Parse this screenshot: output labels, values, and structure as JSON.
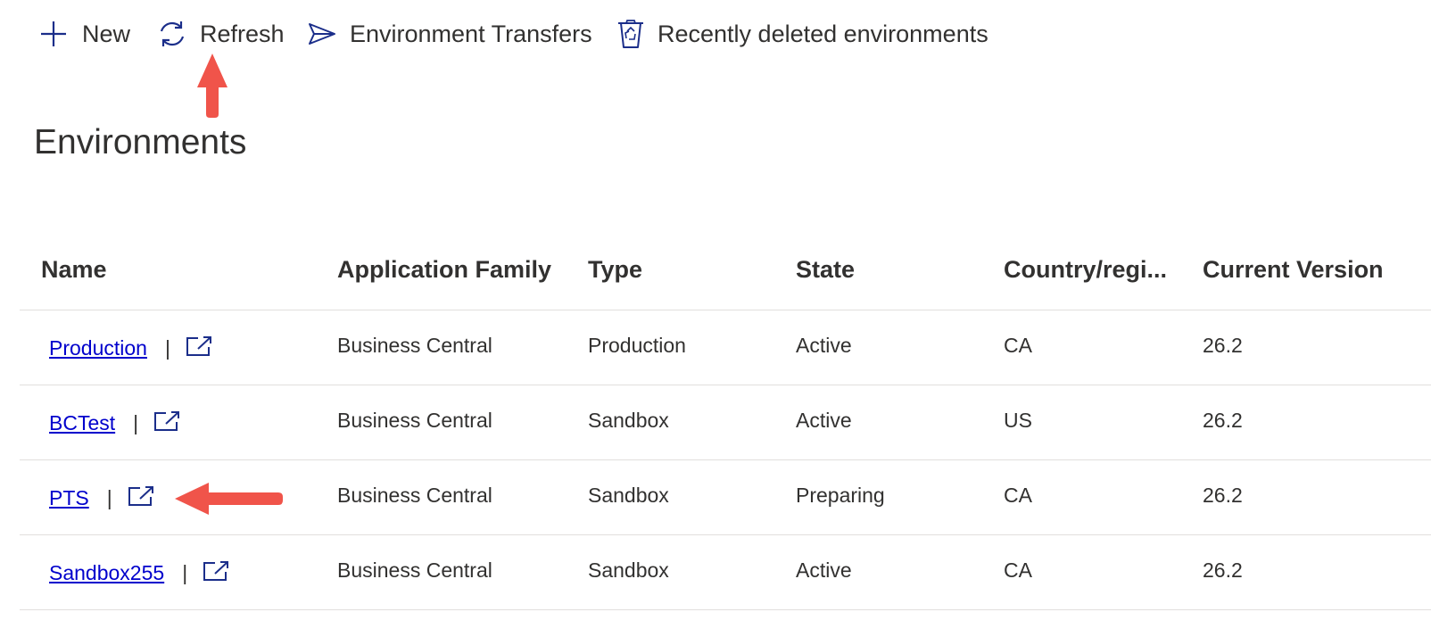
{
  "commandbar": {
    "new_label": "New",
    "refresh_label": "Refresh",
    "transfers_label": "Environment Transfers",
    "deleted_label": "Recently deleted environments"
  },
  "page": {
    "title": "Environments"
  },
  "table": {
    "columns": [
      "Name",
      "Application Family",
      "Type",
      "State",
      "Country/regi...",
      "Current Version"
    ],
    "rows": [
      {
        "name": "Production",
        "family": "Business Central",
        "type": "Production",
        "state": "Active",
        "country": "CA",
        "version": "26.2"
      },
      {
        "name": "BCTest",
        "family": "Business Central",
        "type": "Sandbox",
        "state": "Active",
        "country": "US",
        "version": "26.2"
      },
      {
        "name": "PTS",
        "family": "Business Central",
        "type": "Sandbox",
        "state": "Preparing",
        "country": "CA",
        "version": "26.2"
      },
      {
        "name": "Sandbox255",
        "family": "Business Central",
        "type": "Sandbox",
        "state": "Active",
        "country": "CA",
        "version": "26.2"
      }
    ],
    "separator": "|"
  },
  "colors": {
    "icon": "#1b2e8a",
    "link": "#0000cc",
    "annotation": "#f0544a"
  },
  "icons": [
    "plus-icon",
    "refresh-icon",
    "send-icon",
    "recycle-bin-icon",
    "open-in-new-window-icon"
  ]
}
